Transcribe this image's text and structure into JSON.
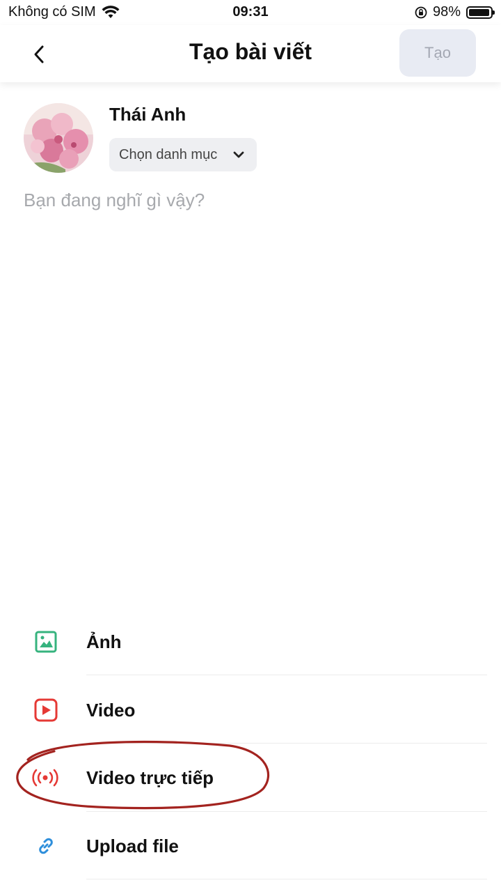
{
  "status_bar": {
    "carrier": "Không có SIM",
    "time": "09:31",
    "battery": "98%",
    "battery_level": 0.98
  },
  "header": {
    "title": "Tạo bài viết",
    "create_label": "Tạo"
  },
  "composer": {
    "user_name": "Thái Anh",
    "category_label": "Chọn danh mục",
    "placeholder": "Bạn đang nghĩ gì vậy?"
  },
  "options": [
    {
      "label": "Ảnh",
      "icon": "image-icon",
      "color": "#36b37e"
    },
    {
      "label": "Video",
      "icon": "video-play-icon",
      "color": "#e53935"
    },
    {
      "label": "Video trực tiếp",
      "icon": "live-broadcast-icon",
      "color": "#e53935"
    },
    {
      "label": "Upload file",
      "icon": "link-icon",
      "color": "#2f8fdb"
    }
  ],
  "annotation": {
    "color": "#a3231f",
    "target": "Video trực tiếp"
  }
}
